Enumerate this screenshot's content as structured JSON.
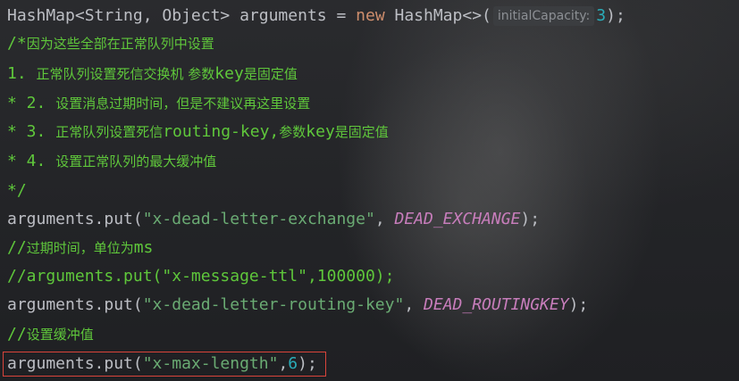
{
  "code": {
    "line1": {
      "type_decl": "HashMap<String, Object> arguments = ",
      "kw_new": "new",
      "ctor": " HashMap<>(",
      "hint_label": "initialCapacity:",
      "hint_value": "3",
      "end": ");"
    },
    "line2": {
      "slash": "/*",
      "text": "因为这些全部在正常队列中设置"
    },
    "line3": {
      "prefix": "1. ",
      "t1": "正常队列设置死信交换机 参数",
      "k": "key",
      "t2": "是固定值"
    },
    "line4": {
      "prefix": "* 2. ",
      "text": "设置消息过期时间，但是不建议再这里设置"
    },
    "line5": {
      "prefix": "* 3. ",
      "t1": "正常队列设置死信",
      "k1": "routing-key,",
      "t2": "参数",
      "k2": "key",
      "t3": "是固定值"
    },
    "line6": {
      "prefix": "* 4. ",
      "text": "设置正常队列的最大缓冲值"
    },
    "line7": {
      "text": "*/"
    },
    "line8": {
      "call": "arguments.put(",
      "str": "\"x-dead-letter-exchange\"",
      "sep": ", ",
      "const": "DEAD_EXCHANGE",
      "end": ");"
    },
    "line9": {
      "slash": "//",
      "text": "过期时间，单位为",
      "unit": "ms"
    },
    "line10": {
      "text": "//arguments.put(\"x-message-ttl\",100000);"
    },
    "line11": {
      "call": "arguments.put(",
      "str": "\"x-dead-letter-routing-key\"",
      "sep": ", ",
      "const": "DEAD_ROUTINGKEY",
      "end": ");"
    },
    "line12": {
      "slash": "//",
      "text": "设置缓冲值"
    },
    "line13": {
      "call": "arguments.put(",
      "str": "\"x-max-length\"",
      "sep": ",",
      "num": "6",
      "end": ");"
    }
  },
  "colors": {
    "default": "#bcbec4",
    "keyword": "#cf8e6d",
    "string": "#6aab73",
    "number": "#2aacb8",
    "constant": "#c77dbb",
    "comment": "#5fc73b",
    "highlight_border": "#d9443b"
  }
}
